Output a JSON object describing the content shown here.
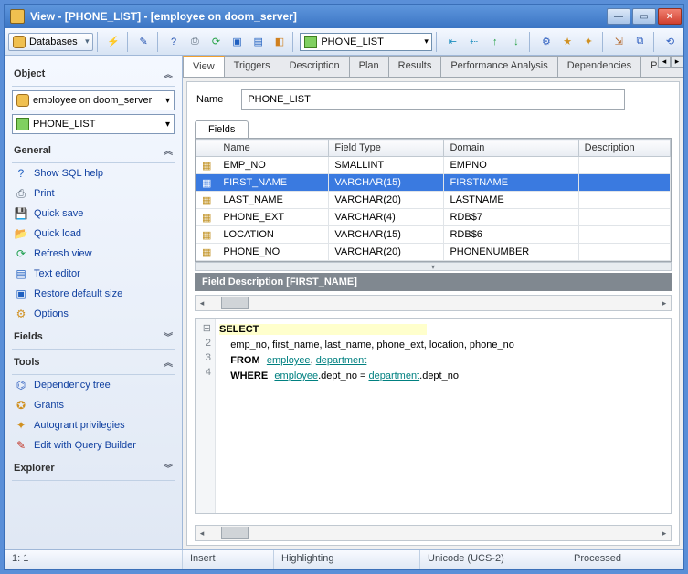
{
  "title": "View - [PHONE_LIST] - [employee on doom_server]",
  "toolbar": {
    "databases_label": "Databases",
    "combo_value": "PHONE_LIST"
  },
  "sidebar": {
    "object_hdr": "Object",
    "combo1": "employee on doom_server",
    "combo2": "PHONE_LIST",
    "general_hdr": "General",
    "general_items": [
      "Show SQL help",
      "Print",
      "Quick save",
      "Quick load",
      "Refresh view",
      "Text editor",
      "Restore default size",
      "Options"
    ],
    "fields_hdr": "Fields",
    "tools_hdr": "Tools",
    "tools_items": [
      "Dependency tree",
      "Grants",
      "Autogrant privilegies",
      "Edit with Query Builder"
    ],
    "explorer_hdr": "Explorer"
  },
  "tabs": [
    "View",
    "Triggers",
    "Description",
    "Plan",
    "Results",
    "Performance Analysis",
    "Dependencies",
    "Permissions"
  ],
  "name_label": "Name",
  "name_value": "PHONE_LIST",
  "fields_label": "Fields",
  "grid": {
    "headers": [
      "Name",
      "Field Type",
      "Domain",
      "Description"
    ],
    "rows": [
      {
        "name": "EMP_NO",
        "type": "SMALLINT",
        "domain": "EMPNO",
        "desc": ""
      },
      {
        "name": "FIRST_NAME",
        "type": "VARCHAR(15)",
        "domain": "FIRSTNAME",
        "desc": ""
      },
      {
        "name": "LAST_NAME",
        "type": "VARCHAR(20)",
        "domain": "LASTNAME",
        "desc": ""
      },
      {
        "name": "PHONE_EXT",
        "type": "VARCHAR(4)",
        "domain": "RDB$7",
        "desc": ""
      },
      {
        "name": "LOCATION",
        "type": "VARCHAR(15)",
        "domain": "RDB$6",
        "desc": ""
      },
      {
        "name": "PHONE_NO",
        "type": "VARCHAR(20)",
        "domain": "PHONENUMBER",
        "desc": ""
      }
    ],
    "selected_index": 1
  },
  "field_desc_label": "Field Description [FIRST_NAME]",
  "sql": {
    "l1_kw": "SELECT",
    "l2": "    emp_no, first_name, last_name, phone_ext, location, phone_no",
    "l3_pre": "    ",
    "l3_kw": "FROM",
    "l3_a": "employee",
    "l3_comma": ", ",
    "l3_b": "department",
    "l4_pre": "    ",
    "l4_kw": "WHERE",
    "l4_a": "employee",
    "l4_mid": ".dept_no = ",
    "l4_b": "department",
    "l4_end": ".dept_no"
  },
  "status": {
    "pos": "1:   1",
    "mode": "Insert",
    "hl": "Highlighting",
    "enc": "Unicode (UCS-2)",
    "last": "Processed"
  }
}
